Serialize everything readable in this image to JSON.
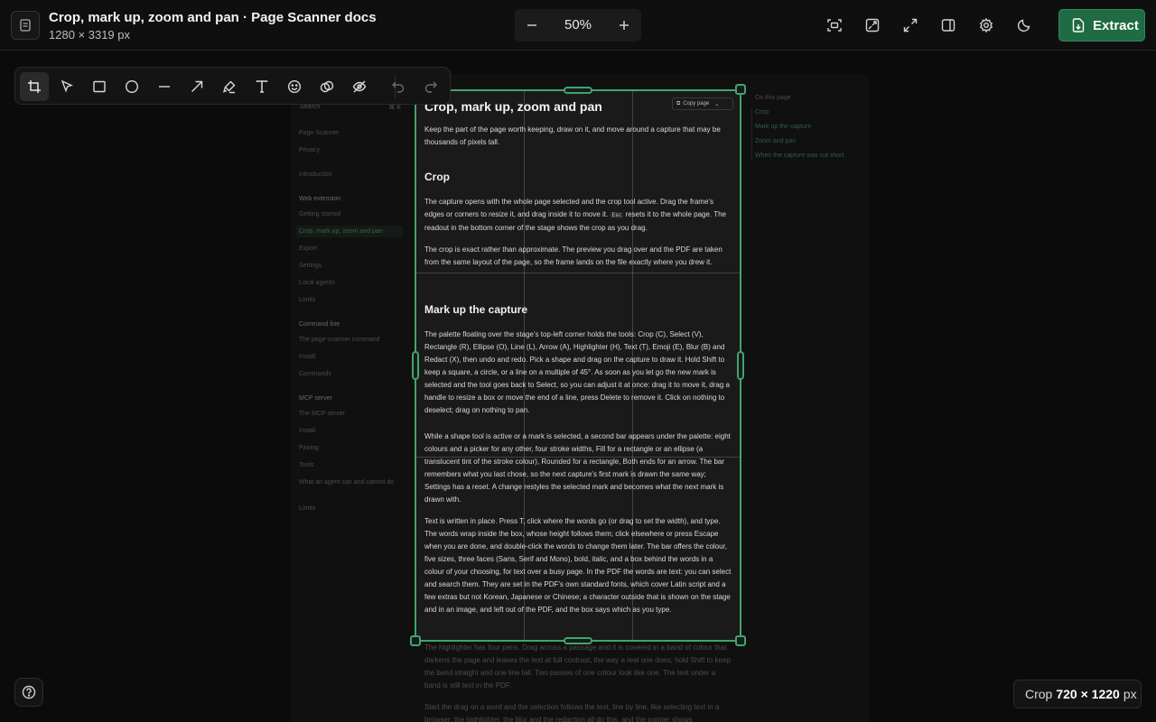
{
  "header": {
    "title": "Crop, mark up, zoom and pan · Page Scanner docs",
    "dimensions": "1280 × 3319 px",
    "zoom": {
      "out_icon": "minus-icon",
      "level": "50%",
      "in_icon": "plus-icon"
    },
    "icons": [
      "fit-screen-icon",
      "screenshot-icon",
      "expand-icon",
      "split-panel-icon",
      "gear-icon",
      "moon-icon"
    ],
    "extract_label": "Extract",
    "accent": "#1f6b43"
  },
  "palette": {
    "tools": [
      "crop-icon",
      "select-arrow-icon",
      "rectangle-icon",
      "ellipse-icon",
      "line-icon",
      "arrow-icon",
      "highlighter-icon",
      "text-icon",
      "emoji-icon",
      "blur-icon",
      "redact-icon"
    ],
    "active": "crop-icon",
    "history": [
      "undo-icon",
      "redo-icon"
    ]
  },
  "sidebar": {
    "search_placeholder": "Search",
    "search_kbd": "⌘ K",
    "items": [
      {
        "label": "Page Scanner"
      },
      {
        "label": "Privacy"
      },
      {
        "label": "Introduction"
      },
      {
        "label": "Web extension"
      },
      {
        "label": "Getting started"
      },
      {
        "label": "Crop, mark up, zoom and pan"
      },
      {
        "label": "Export"
      },
      {
        "label": "Settings"
      },
      {
        "label": "Local agents"
      },
      {
        "label": "Limits"
      },
      {
        "label": "Command line"
      },
      {
        "label": "The page-scanner command"
      },
      {
        "label": "Install"
      },
      {
        "label": "Commands"
      },
      {
        "label": "MCP server"
      },
      {
        "label": "The MCP server"
      },
      {
        "label": "Install"
      },
      {
        "label": "Pairing"
      },
      {
        "label": "Tools"
      },
      {
        "label": "What an agent can and cannot do"
      },
      {
        "label": "Limits"
      }
    ]
  },
  "on_this_page": {
    "heading": "On this page",
    "links": [
      "Crop",
      "Mark up the capture",
      "Zoom and pan",
      "When the capture was cut short"
    ]
  },
  "doc": {
    "h1": "Crop, mark up, zoom and pan",
    "copy_label": "Copy page",
    "intro": "Keep the part of the page worth keeping, draw on it, and move around a capture that may be thousands of pixels tall.",
    "crop_heading": "Crop",
    "crop_p1a": "The capture opens with the whole page selected and the crop tool active. Drag the frame's edges or corners to resize it, and drag inside it to move it.",
    "kbd_esc": "Esc",
    "crop_p1b": "resets it to the whole page. The readout in the bottom corner of the stage shows the crop as you drag.",
    "crop_p2": "The crop is exact rather than approximate. The preview you drag over and the PDF are taken from the same layout of the page, so the frame lands on the file exactly where you drew it.",
    "markup_heading": "Mark up the capture",
    "markup_p1": "The palette floating over the stage's top-left corner holds the tools: Crop (C), Select (V), Rectangle (R), Ellipse (O), Line (L), Arrow (A), Highlighter (H), Text (T), Emoji (E), Blur (B) and Redact (X), then undo and redo. Pick a shape and drag on the capture to draw it. Hold Shift to keep a square, a circle, or a line on a multiple of 45°. As soon as you let go the new mark is selected and the tool goes back to Select, so you can adjust it at once: drag it to move it, drag a handle to resize a box or move the end of a line, press Delete to remove it. Click on nothing to deselect; drag on nothing to pan.",
    "markup_p2": "While a shape tool is active or a mark is selected, a second bar appears under the palette: eight colours and a picker for any other, four stroke widths, Fill for a rectangle or an ellipse (a translucent tint of the stroke colour), Rounded for a rectangle, Both ends for an arrow. The bar remembers what you last chose, so the next capture's first mark is drawn the same way; Settings has a reset. A change restyles the selected mark and becomes what the next mark is drawn with.",
    "markup_p3": "Text is written in place. Press T, click where the words go (or drag to set the width), and type. The words wrap inside the box, whose height follows them; click elsewhere or press Escape when you are done, and double-click the words to change them later. The bar offers the colour, five sizes, three faces (Sans, Serif and Mono), bold, italic, and a box behind the words in a colour of your choosing, for text over a busy page. In the PDF the words are text: you can select and search them. They are set in the PDF's own standard fonts, which cover Latin script and a few extras but not Korean, Japanese or Chinese; a character outside that is shown on the stage and in an image, and left out of the PDF, and the box says which as you type.",
    "below_p1": "The highlighter has four pens. Drag across a passage and it is covered in a band of colour that darkens the page and leaves the text at full contrast, the way a real one does; hold Shift to keep the band straight and one line tall. Two passes of one colour look like one. The text under a band is still text in the PDF.",
    "below_p2": "Start the drag on a word and the selection follows the text, line by line, like selecting text in a browser: the highlighter, the blur and the redaction all do this, and the pointer shows"
  },
  "help_icon": "question-circle-icon",
  "readout": {
    "label": "Crop",
    "value": "720 × 1220",
    "unit": "px"
  }
}
